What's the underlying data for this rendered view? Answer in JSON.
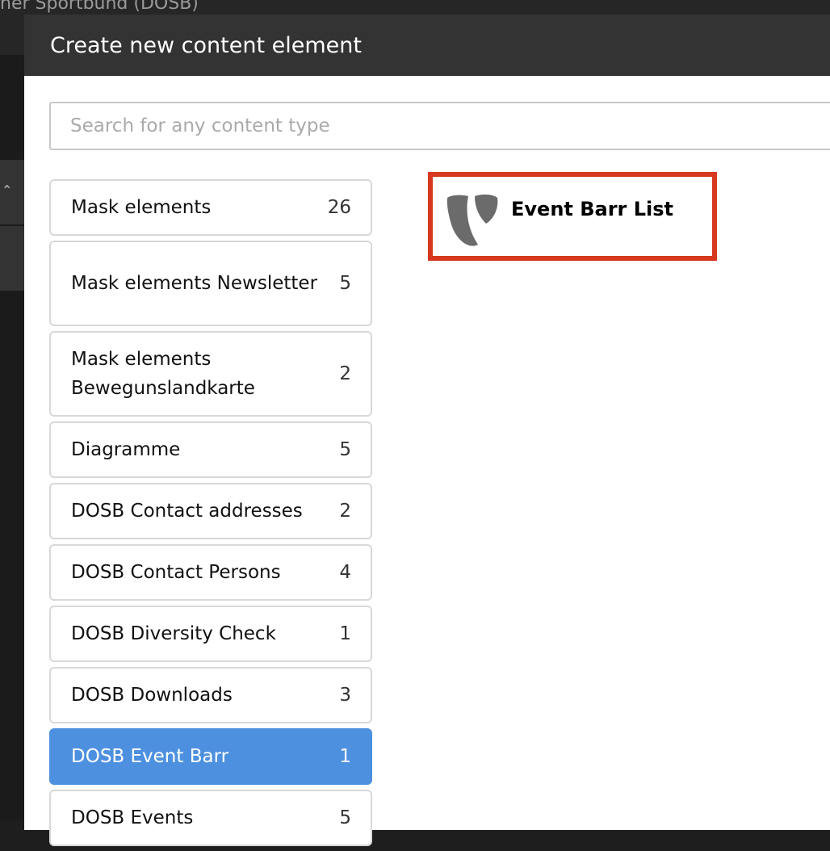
{
  "background": {
    "title": "her Sportbund (DOSB)"
  },
  "modal": {
    "title": "Create new content element",
    "search": {
      "placeholder": "Search for any content type",
      "value": ""
    }
  },
  "categories": [
    {
      "label": "Mask elements",
      "count": "26"
    },
    {
      "label": "Mask elements Newsletter",
      "count": "5"
    },
    {
      "label": "Mask elements Bewegunslandkarte",
      "count": "2"
    },
    {
      "label": "Diagramme",
      "count": "5"
    },
    {
      "label": "DOSB Contact addresses",
      "count": "2"
    },
    {
      "label": "DOSB Contact Persons",
      "count": "4"
    },
    {
      "label": "DOSB Diversity Check",
      "count": "1"
    },
    {
      "label": "DOSB Downloads",
      "count": "3"
    },
    {
      "label": "DOSB Event Barr",
      "count": "1",
      "active": true
    },
    {
      "label": "DOSB Events",
      "count": "5"
    }
  ],
  "element": {
    "label": "Event Barr List",
    "icon": "typo3-logo-icon"
  },
  "colors": {
    "active": "#4d90e0",
    "highlight": "#d6391f",
    "header": "#333333"
  }
}
